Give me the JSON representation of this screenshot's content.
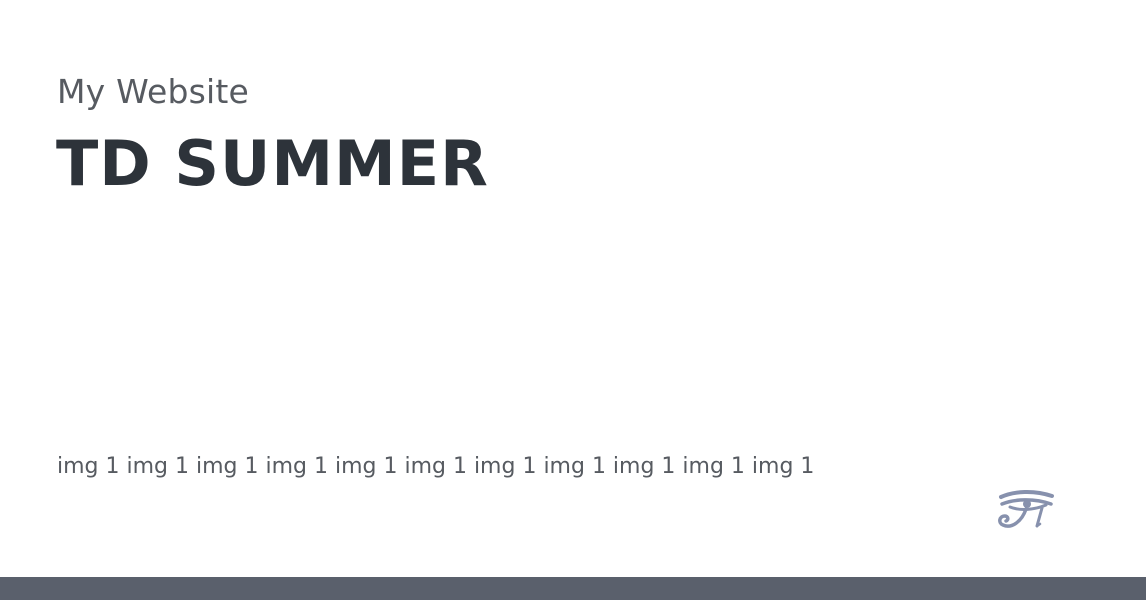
{
  "site": {
    "name": "My Website"
  },
  "page": {
    "title": "TD SUMMER",
    "description": "img 1 img 1 img 1 img 1 img 1 img 1 img 1 img 1 img 1 img 1 img 1"
  },
  "logo": {
    "icon": "eye-of-horus-icon",
    "color": "#8791ad"
  },
  "colors": {
    "background": "#ffffff",
    "site_name": "#575b61",
    "title": "#2d333a",
    "description": "#575b61",
    "footer_bar": "#5a606c"
  }
}
